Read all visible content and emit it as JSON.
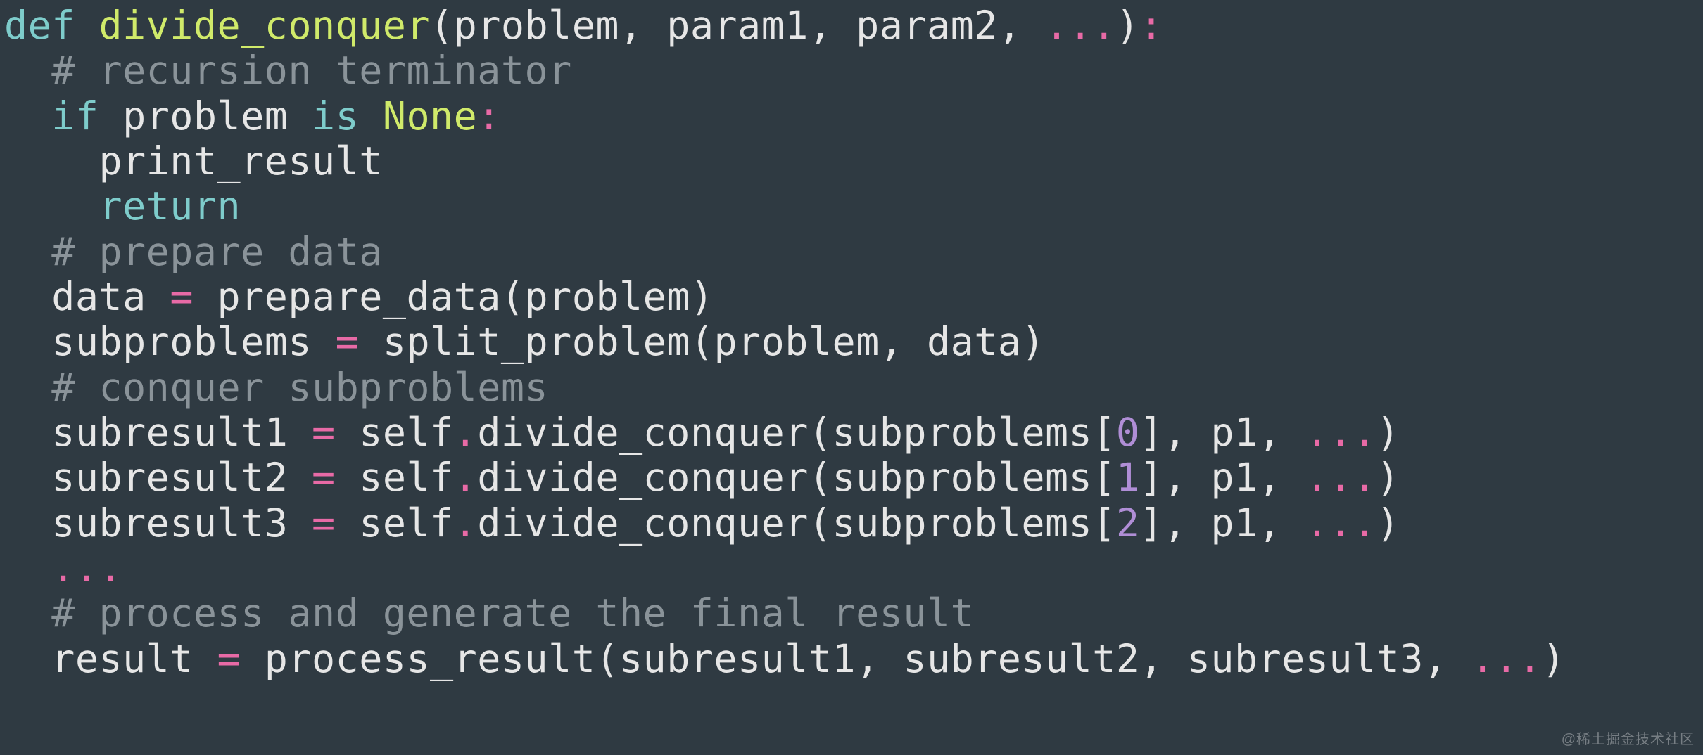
{
  "colors": {
    "background": "#2f3a42",
    "text": "#e6e6e6",
    "keyword": "#7ecccb",
    "function": "#d0ea6a",
    "none": "#d0ea6a",
    "number": "#b08ed6",
    "operator": "#e86aa6",
    "comment": "#8a9399"
  },
  "watermark": "@稀土掘金技术社区",
  "code": {
    "language": "python",
    "lines": [
      {
        "indent": 0,
        "tokens": [
          {
            "t": "def ",
            "c": "kw"
          },
          {
            "t": "divide_conquer",
            "c": "fn"
          },
          {
            "t": "(",
            "c": "pn"
          },
          {
            "t": "problem",
            "c": "id"
          },
          {
            "t": ", ",
            "c": "pn"
          },
          {
            "t": "param1",
            "c": "id"
          },
          {
            "t": ", ",
            "c": "pn"
          },
          {
            "t": "param2",
            "c": "id"
          },
          {
            "t": ", ",
            "c": "pn"
          },
          {
            "t": "...",
            "c": "op"
          },
          {
            "t": ")",
            "c": "pn"
          },
          {
            "t": ":",
            "c": "op"
          }
        ]
      },
      {
        "indent": 1,
        "tokens": [
          {
            "t": "# recursion terminator",
            "c": "cm"
          }
        ]
      },
      {
        "indent": 1,
        "tokens": [
          {
            "t": "if ",
            "c": "kw"
          },
          {
            "t": "problem ",
            "c": "id"
          },
          {
            "t": "is ",
            "c": "kw"
          },
          {
            "t": "None",
            "c": "none"
          },
          {
            "t": ":",
            "c": "op"
          }
        ]
      },
      {
        "indent": 2,
        "tokens": [
          {
            "t": "print_result",
            "c": "id"
          }
        ]
      },
      {
        "indent": 2,
        "tokens": [
          {
            "t": "return",
            "c": "kw"
          }
        ]
      },
      {
        "indent": 1,
        "tokens": [
          {
            "t": "# prepare data",
            "c": "cm"
          }
        ]
      },
      {
        "indent": 1,
        "tokens": [
          {
            "t": "data ",
            "c": "id"
          },
          {
            "t": "=",
            "c": "op"
          },
          {
            "t": " prepare_data",
            "c": "id"
          },
          {
            "t": "(",
            "c": "pn"
          },
          {
            "t": "problem",
            "c": "id"
          },
          {
            "t": ")",
            "c": "pn"
          }
        ]
      },
      {
        "indent": 1,
        "tokens": [
          {
            "t": "subproblems ",
            "c": "id"
          },
          {
            "t": "=",
            "c": "op"
          },
          {
            "t": " split_problem",
            "c": "id"
          },
          {
            "t": "(",
            "c": "pn"
          },
          {
            "t": "problem",
            "c": "id"
          },
          {
            "t": ", ",
            "c": "pn"
          },
          {
            "t": "data",
            "c": "id"
          },
          {
            "t": ")",
            "c": "pn"
          }
        ]
      },
      {
        "indent": 1,
        "tokens": [
          {
            "t": "# conquer subproblems",
            "c": "cm"
          }
        ]
      },
      {
        "indent": 1,
        "tokens": [
          {
            "t": "subresult1 ",
            "c": "id"
          },
          {
            "t": "=",
            "c": "op"
          },
          {
            "t": " self",
            "c": "id"
          },
          {
            "t": ".",
            "c": "op"
          },
          {
            "t": "divide_conquer",
            "c": "id"
          },
          {
            "t": "(",
            "c": "pn"
          },
          {
            "t": "subproblems",
            "c": "id"
          },
          {
            "t": "[",
            "c": "pn"
          },
          {
            "t": "0",
            "c": "num"
          },
          {
            "t": "]",
            "c": "pn"
          },
          {
            "t": ", ",
            "c": "pn"
          },
          {
            "t": "p1",
            "c": "id"
          },
          {
            "t": ", ",
            "c": "pn"
          },
          {
            "t": "...",
            "c": "op"
          },
          {
            "t": ")",
            "c": "pn"
          }
        ]
      },
      {
        "indent": 1,
        "tokens": [
          {
            "t": "subresult2 ",
            "c": "id"
          },
          {
            "t": "=",
            "c": "op"
          },
          {
            "t": " self",
            "c": "id"
          },
          {
            "t": ".",
            "c": "op"
          },
          {
            "t": "divide_conquer",
            "c": "id"
          },
          {
            "t": "(",
            "c": "pn"
          },
          {
            "t": "subproblems",
            "c": "id"
          },
          {
            "t": "[",
            "c": "pn"
          },
          {
            "t": "1",
            "c": "num"
          },
          {
            "t": "]",
            "c": "pn"
          },
          {
            "t": ", ",
            "c": "pn"
          },
          {
            "t": "p1",
            "c": "id"
          },
          {
            "t": ", ",
            "c": "pn"
          },
          {
            "t": "...",
            "c": "op"
          },
          {
            "t": ")",
            "c": "pn"
          }
        ]
      },
      {
        "indent": 1,
        "tokens": [
          {
            "t": "subresult3 ",
            "c": "id"
          },
          {
            "t": "=",
            "c": "op"
          },
          {
            "t": " self",
            "c": "id"
          },
          {
            "t": ".",
            "c": "op"
          },
          {
            "t": "divide_conquer",
            "c": "id"
          },
          {
            "t": "(",
            "c": "pn"
          },
          {
            "t": "subproblems",
            "c": "id"
          },
          {
            "t": "[",
            "c": "pn"
          },
          {
            "t": "2",
            "c": "num"
          },
          {
            "t": "]",
            "c": "pn"
          },
          {
            "t": ", ",
            "c": "pn"
          },
          {
            "t": "p1",
            "c": "id"
          },
          {
            "t": ", ",
            "c": "pn"
          },
          {
            "t": "...",
            "c": "op"
          },
          {
            "t": ")",
            "c": "pn"
          }
        ]
      },
      {
        "indent": 1,
        "tokens": [
          {
            "t": "...",
            "c": "op"
          }
        ]
      },
      {
        "indent": 1,
        "tokens": [
          {
            "t": "# process and generate the final result",
            "c": "cm"
          }
        ]
      },
      {
        "indent": 1,
        "tokens": [
          {
            "t": "result ",
            "c": "id"
          },
          {
            "t": "=",
            "c": "op"
          },
          {
            "t": " process_result",
            "c": "id"
          },
          {
            "t": "(",
            "c": "pn"
          },
          {
            "t": "subresult1",
            "c": "id"
          },
          {
            "t": ", ",
            "c": "pn"
          },
          {
            "t": "subresult2",
            "c": "id"
          },
          {
            "t": ", ",
            "c": "pn"
          },
          {
            "t": "subresult3",
            "c": "id"
          },
          {
            "t": ", ",
            "c": "pn"
          },
          {
            "t": "...",
            "c": "op"
          },
          {
            "t": ")",
            "c": "pn"
          }
        ]
      }
    ]
  }
}
